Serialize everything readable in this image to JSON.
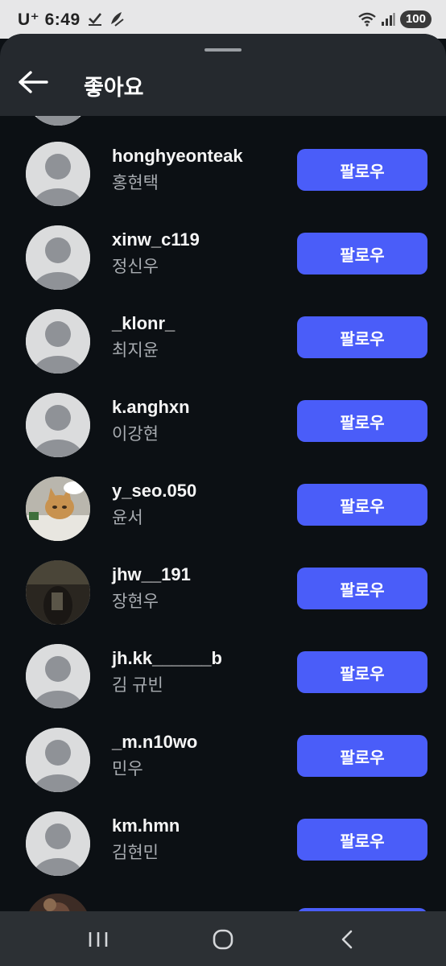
{
  "status_bar": {
    "carrier": "U⁺",
    "time": "6:49",
    "battery": "100"
  },
  "header": {
    "title": "좋아요"
  },
  "likes": [
    {
      "username": "honghyeonteak",
      "full_name": "홍현택",
      "button": "팔로우",
      "avatar": "default-avatar"
    },
    {
      "username": "xinw_c119",
      "full_name": "정신우",
      "button": "팔로우",
      "avatar": "default-avatar"
    },
    {
      "username": "_klonr_",
      "full_name": "최지윤",
      "button": "팔로우",
      "avatar": "default-avatar"
    },
    {
      "username": "k.anghxn",
      "full_name": "이강현",
      "button": "팔로우",
      "avatar": "default-avatar"
    },
    {
      "username": "y_seo.050",
      "full_name": "윤서",
      "button": "팔로우",
      "avatar": "cat-photo"
    },
    {
      "username": "jhw__191",
      "full_name": "장현우",
      "button": "팔로우",
      "avatar": "dark-photo"
    },
    {
      "username": "jh.kk______b",
      "full_name": "김 규빈",
      "button": "팔로우",
      "avatar": "default-avatar"
    },
    {
      "username": "_m.n10wo",
      "full_name": "민우",
      "button": "팔로우",
      "avatar": "default-avatar"
    },
    {
      "username": "km.hmn",
      "full_name": "김현민",
      "button": "팔로우",
      "avatar": "default-avatar"
    }
  ],
  "colors": {
    "background": "#0c1014",
    "header": "#25292e",
    "follow_button": "#4a5df9",
    "secondary_text": "#a8acb1",
    "nav_bar": "#2c3034"
  },
  "navigation": {
    "icons": [
      "recent-apps-icon",
      "home-icon",
      "back-nav-icon"
    ]
  }
}
